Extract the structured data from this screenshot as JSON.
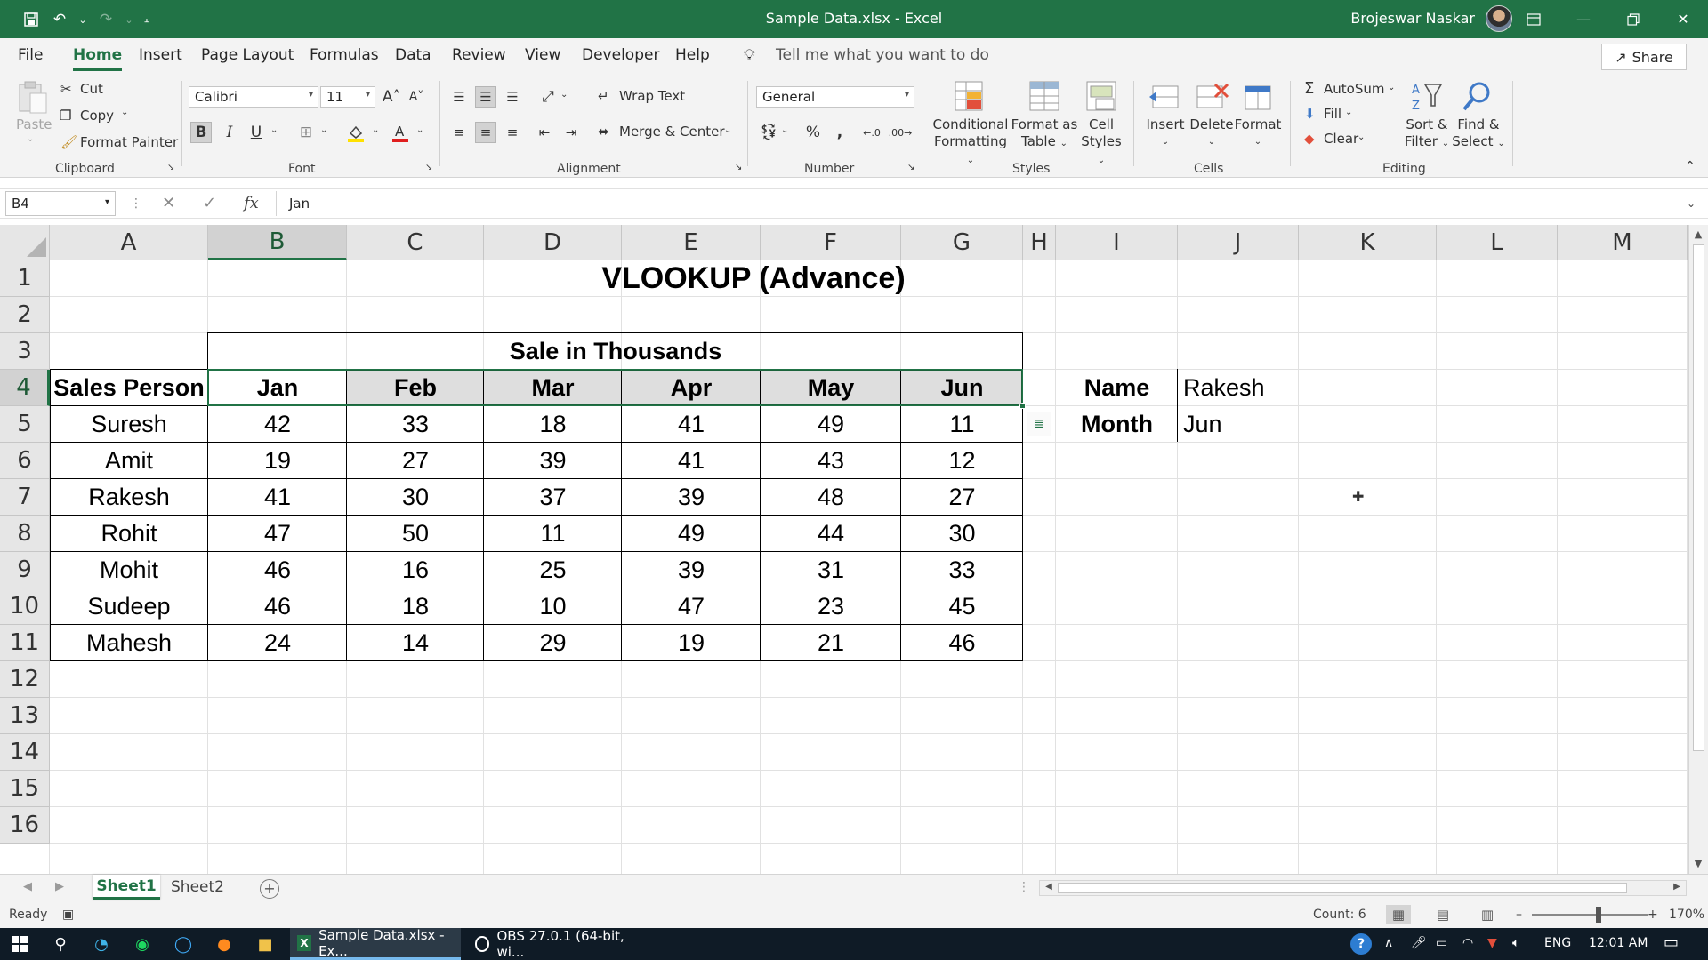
{
  "window": {
    "title": "Sample Data.xlsx  -  Excel",
    "user_name": "Brojeswar Naskar",
    "ribbon_display_icon": "ribbon-display-icon",
    "minimize_icon": "minimize-icon",
    "restore_icon": "restore-icon",
    "close_icon": "close-icon"
  },
  "menu_tabs": [
    "File",
    "Home",
    "Insert",
    "Page Layout",
    "Formulas",
    "Data",
    "Review",
    "View",
    "Developer",
    "Help"
  ],
  "tell_me": "Tell me what you want to do",
  "share_label": "Share",
  "ribbon": {
    "clipboard": {
      "paste": "Paste",
      "cut": "Cut",
      "copy": "Copy",
      "format_painter": "Format Painter",
      "label": "Clipboard"
    },
    "font": {
      "name": "Calibri",
      "size": "11",
      "label": "Font"
    },
    "alignment": {
      "wrap_text": "Wrap Text",
      "merge_center": "Merge & Center",
      "label": "Alignment"
    },
    "number": {
      "format": "General",
      "label": "Number"
    },
    "styles": {
      "conditional_1": "Conditional",
      "conditional_2": "Formatting",
      "format_table_1": "Format as",
      "format_table_2": "Table",
      "cell_styles_1": "Cell",
      "cell_styles_2": "Styles",
      "label": "Styles"
    },
    "cells": {
      "insert": "Insert",
      "delete": "Delete",
      "format": "Format",
      "label": "Cells"
    },
    "editing": {
      "autosum": "AutoSum",
      "fill": "Fill",
      "clear": "Clear",
      "sort_1": "Sort &",
      "sort_2": "Filter",
      "find_1": "Find &",
      "find_2": "Select",
      "label": "Editing"
    }
  },
  "formula_bar": {
    "name_box": "B4",
    "fx": "fx",
    "value": "Jan"
  },
  "grid": {
    "columns": [
      "A",
      "B",
      "C",
      "D",
      "E",
      "F",
      "G",
      "H",
      "I",
      "J",
      "K",
      "L",
      "M"
    ],
    "rows": [
      "1",
      "2",
      "3",
      "4",
      "5",
      "6",
      "7",
      "8",
      "9",
      "10",
      "11",
      "12",
      "13",
      "14",
      "15",
      "16"
    ],
    "selected_column": "B",
    "selected_row": "4"
  },
  "sheet": {
    "title": "VLOOKUP (Advance)",
    "subtitle": "Sale in Thousands",
    "header_first": "Sales Person",
    "months": [
      "Jan",
      "Feb",
      "Mar",
      "Apr",
      "May",
      "Jun"
    ],
    "rows": [
      {
        "name": "Suresh",
        "values": [
          "42",
          "33",
          "18",
          "41",
          "49",
          "11"
        ]
      },
      {
        "name": "Amit",
        "values": [
          "19",
          "27",
          "39",
          "41",
          "43",
          "12"
        ]
      },
      {
        "name": "Rakesh",
        "values": [
          "41",
          "30",
          "37",
          "39",
          "48",
          "27"
        ]
      },
      {
        "name": "Rohit",
        "values": [
          "47",
          "50",
          "11",
          "49",
          "44",
          "30"
        ]
      },
      {
        "name": "Mohit",
        "values": [
          "46",
          "16",
          "25",
          "39",
          "31",
          "33"
        ]
      },
      {
        "name": "Sudeep",
        "values": [
          "46",
          "18",
          "10",
          "47",
          "23",
          "45"
        ]
      },
      {
        "name": "Mahesh",
        "values": [
          "24",
          "14",
          "29",
          "19",
          "21",
          "46"
        ]
      }
    ],
    "lookup": {
      "name_label": "Name",
      "name_value": "Rakesh",
      "month_label": "Month",
      "month_value": "Jun"
    }
  },
  "sheet_tabs": [
    "Sheet1",
    "Sheet2"
  ],
  "status": {
    "ready": "Ready",
    "count": "Count: 6",
    "zoom": "170%"
  },
  "taskbar": {
    "apps": [
      {
        "label": "Sample Data.xlsx - Ex...",
        "icon": "excel-icon"
      },
      {
        "label": "OBS 27.0.1 (64-bit, wi...",
        "icon": "obs-icon"
      }
    ],
    "lang": "ENG",
    "time": "12:01 AM"
  },
  "colors": {
    "excel_green": "#217346",
    "grid_line": "#e1e1e1",
    "header_bg": "#e6e6e6"
  }
}
